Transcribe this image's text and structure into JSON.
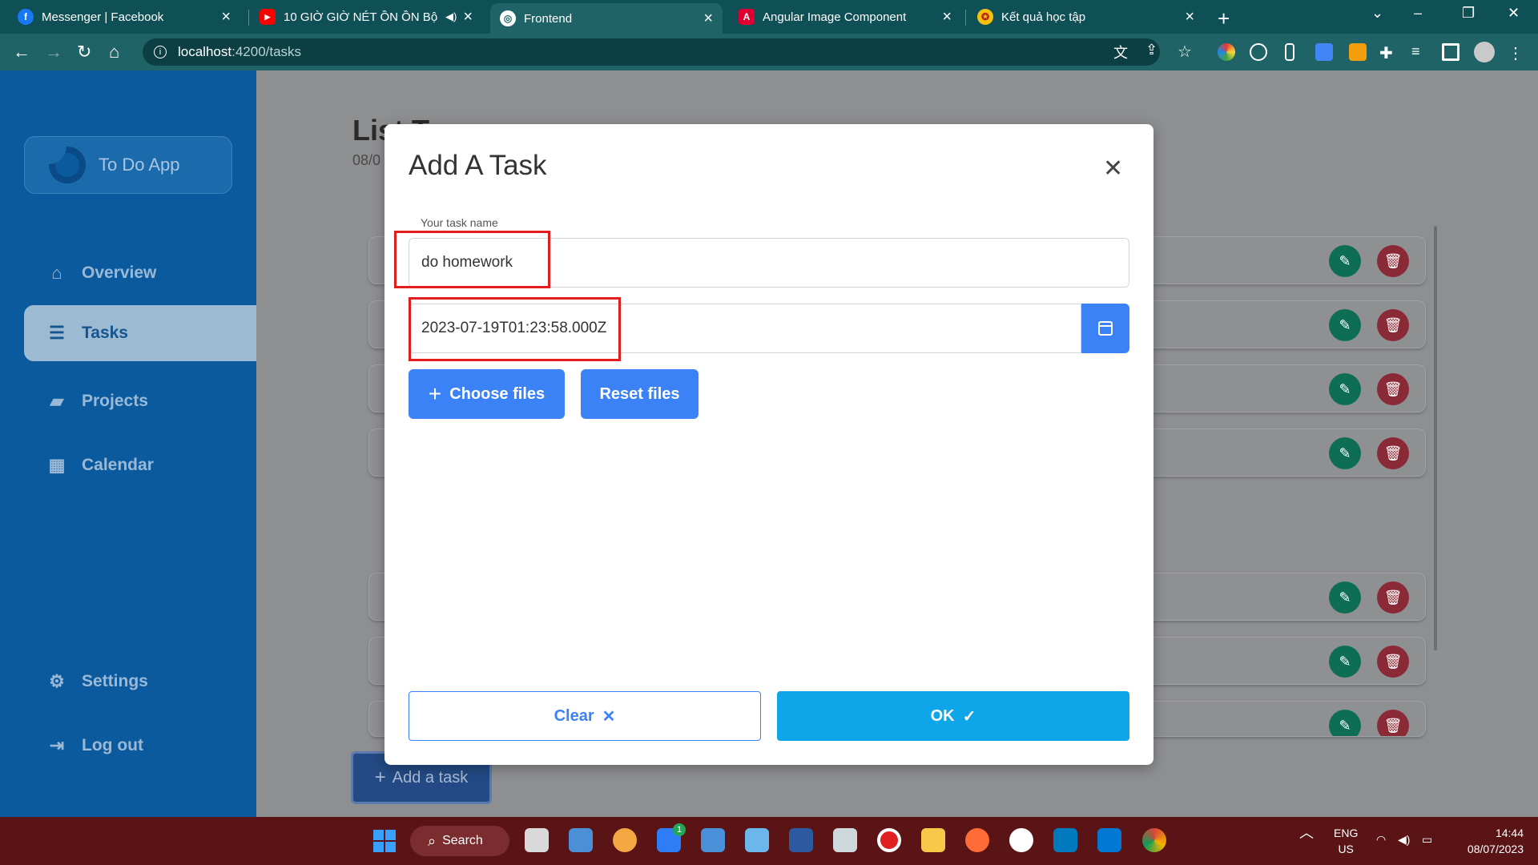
{
  "browser": {
    "tabs": [
      {
        "label": "Messenger | Facebook",
        "color": "#1877f2",
        "glyph": "f"
      },
      {
        "label": "10 GIỜ GIỜ NÉT ỒN ỒN Bộ",
        "color": "#ff0000",
        "glyph": "▶"
      },
      {
        "label": "Frontend",
        "color": "#ffffff",
        "glyph": "◎"
      },
      {
        "label": "Angular Image Component",
        "color": "#dd0031",
        "glyph": "A"
      },
      {
        "label": "Kết quả học tập",
        "color": "#f4c20d",
        "glyph": "✪"
      }
    ],
    "active_tab_index": 2,
    "url_host": "localhost",
    "url_path": ":4200/tasks"
  },
  "app": {
    "logo_text": "To Do App",
    "nav": [
      {
        "label": "Overview",
        "icon": "home-icon",
        "glyph": "⌂"
      },
      {
        "label": "Tasks",
        "icon": "list-icon",
        "glyph": "☰"
      },
      {
        "label": "Projects",
        "icon": "folder-icon",
        "glyph": "▰"
      },
      {
        "label": "Calendar",
        "icon": "calendar-icon",
        "glyph": "▦"
      },
      {
        "label": "Settings",
        "icon": "gear-icon",
        "glyph": "⚙"
      },
      {
        "label": "Log out",
        "icon": "logout-icon",
        "glyph": "⇥"
      }
    ],
    "active_nav": "Tasks",
    "page_title": "List T",
    "page_date": "08/0",
    "add_task_label": "Add a task"
  },
  "modal": {
    "title": "Add A Task",
    "task_name_label": "Your task name",
    "task_name_value": "do homework",
    "date_value": "2023-07-19T01:23:58.000Z",
    "choose_files_label": "Choose files",
    "reset_files_label": "Reset files",
    "clear_label": "Clear",
    "ok_label": "OK"
  },
  "taskbar": {
    "search_label": "Search",
    "lang_top": "ENG",
    "lang_bottom": "US",
    "time": "14:44",
    "date": "08/07/2023",
    "badge_count": "1"
  },
  "colors": {
    "sidebar": "#0b5a9e",
    "primary_button": "#3b82f6",
    "ok_button": "#0ea5e9",
    "highlight_box": "#e11d1d",
    "edit_button": "#0d6e55",
    "delete_button": "#8a2a36"
  }
}
